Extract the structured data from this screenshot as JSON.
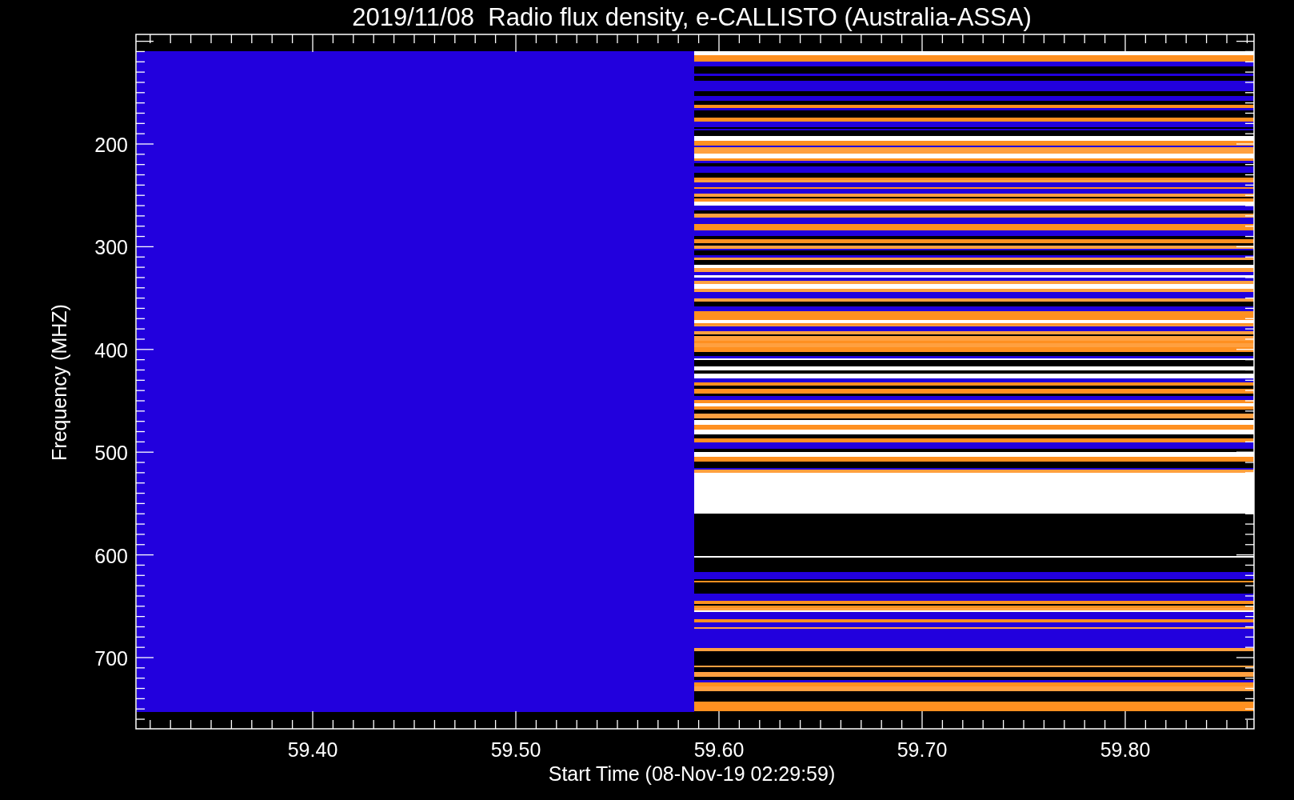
{
  "title": "2019/11/08  Radio flux density, e-CALLISTO (Australia-ASSA)",
  "ylabel": "Frequency (MHZ)",
  "xlabel": "Start Time (08-Nov-19 02:29:59)",
  "yticks": [
    "200",
    "300",
    "400",
    "500",
    "600",
    "700"
  ],
  "xticks": [
    "59.40",
    "59.50",
    "59.60",
    "59.70",
    "59.80"
  ]
}
